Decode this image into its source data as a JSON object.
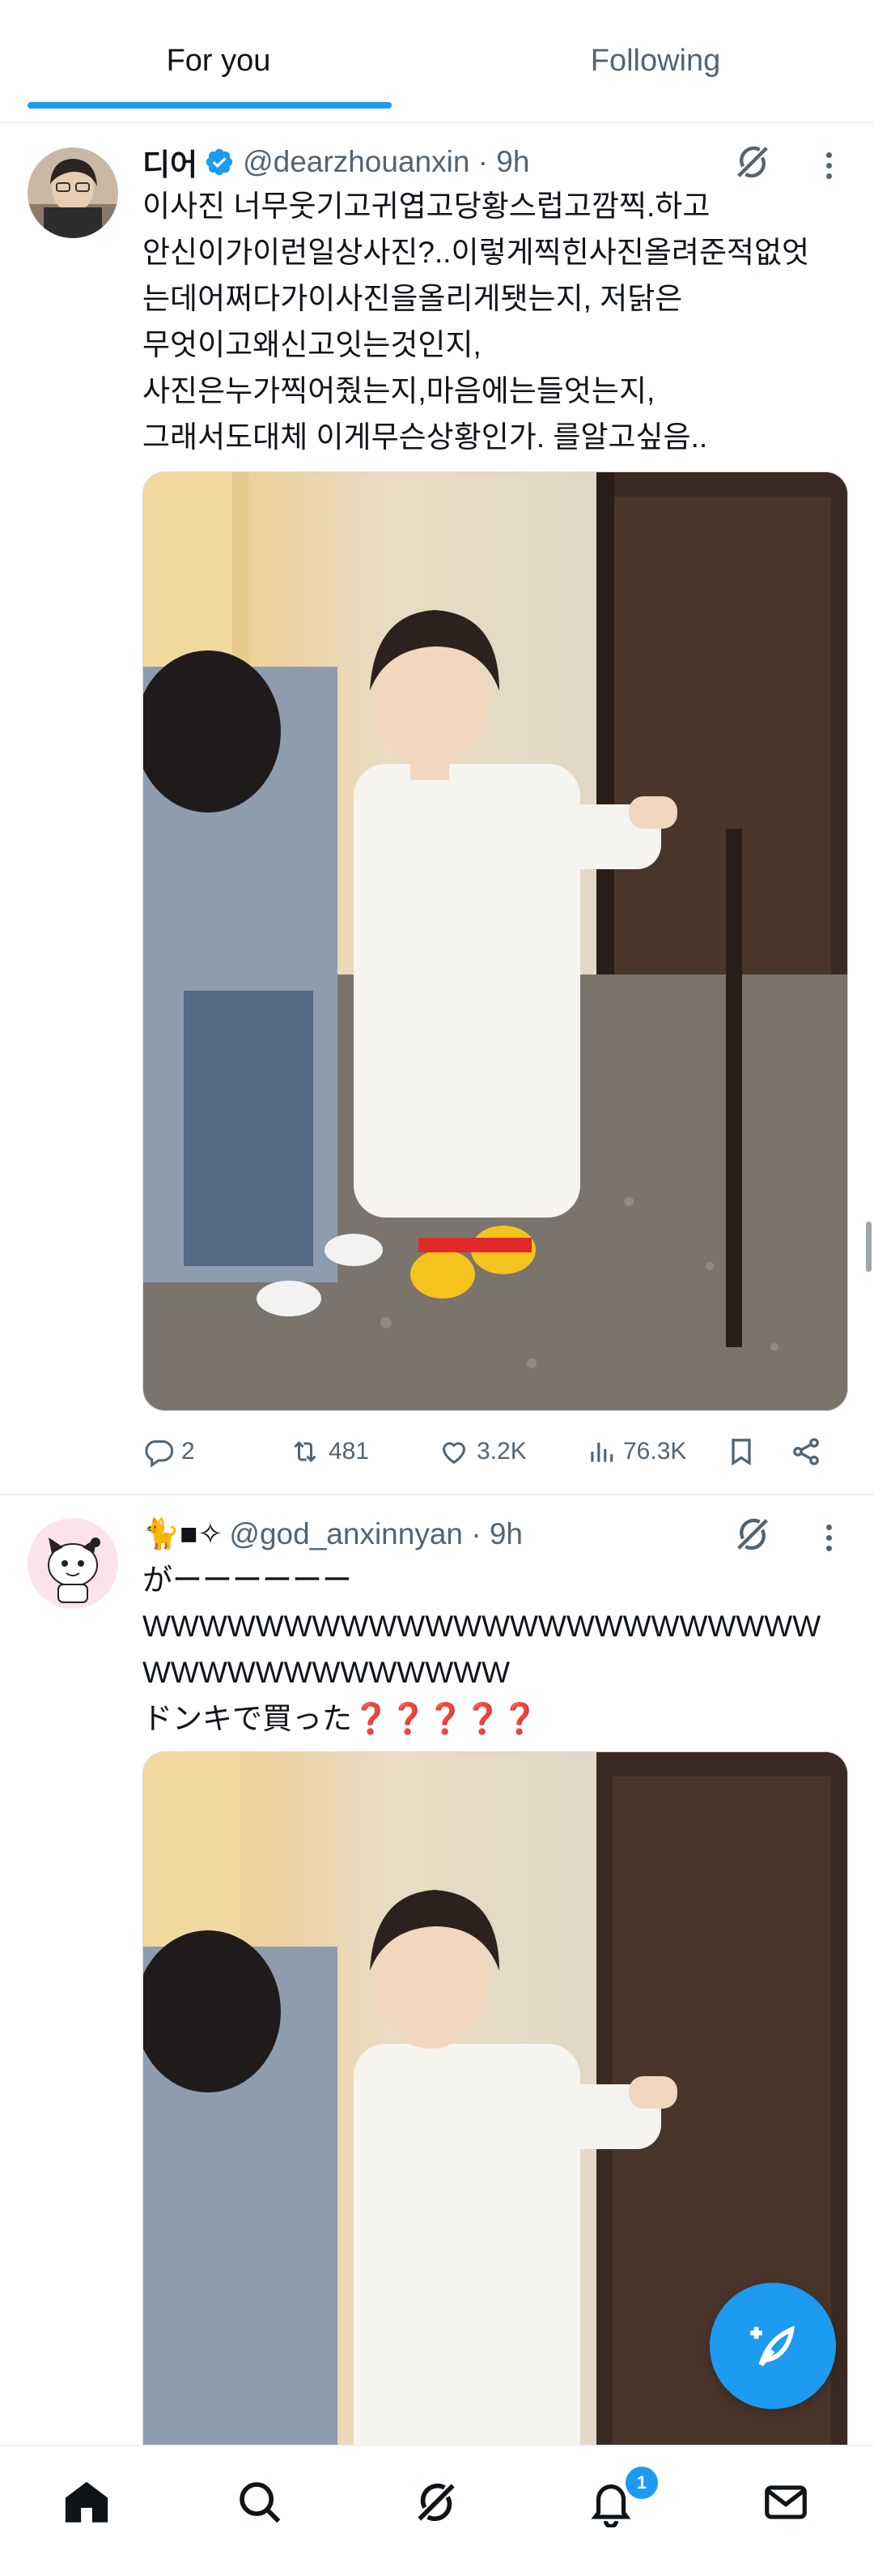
{
  "tabs": {
    "for_you": "For you",
    "following": "Following"
  },
  "tweets": [
    {
      "name": "디어",
      "handle_time": "@dearzhouanxin · 9h",
      "text": "이사진 너무웃기고귀엽고당황스럽고깜찍.하고\n안신이가이런일상사진?..이렇게찍힌사진올려준적없엇\n는데어쩌다가이사진을올리게됏는지, 저닭은\n무엇이고왜신고잇는것인지,\n사진은누가찍어줬는지,마음에는들엇는지,\n그래서도대체 이게무슨상황인가. 를알고싶음..",
      "stats": {
        "replies": "2",
        "reposts": "481",
        "likes": "3.2K",
        "views": "76.3K"
      }
    },
    {
      "name_prefix": "🐈■✧",
      "handle_time": "@god_anxinnyan · 9h",
      "text": "がーーーーーー\nWWWWWWWWWWWWWWWWWWWWWWWWWWWWWWWWWWWWW\nドンキで買った❓❓❓❓❓"
    }
  ],
  "nav": {
    "notification_count": "1"
  },
  "colors": {
    "accent": "#1d9bf0",
    "text": "#0f1419",
    "secondary": "#536471"
  },
  "icons": [
    "home-icon",
    "search-icon",
    "grok-icon",
    "bell-icon",
    "mail-icon",
    "compose-icon",
    "verified-icon",
    "reply-icon",
    "repost-icon",
    "like-icon",
    "views-icon",
    "bookmark-icon",
    "share-icon"
  ]
}
